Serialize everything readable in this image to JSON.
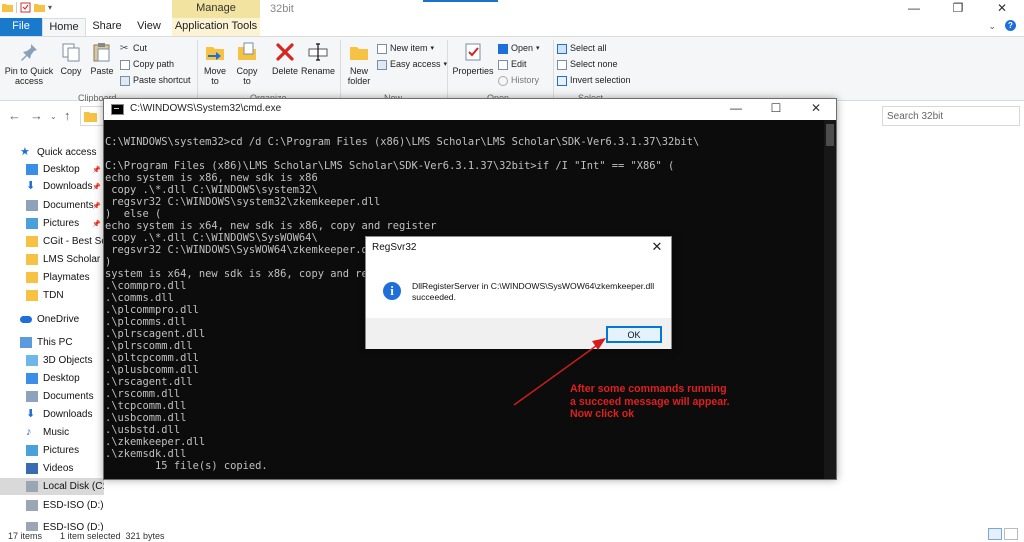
{
  "explorer": {
    "title": "32bit",
    "context_tab_header": "Manage",
    "window_controls": {
      "minimize": "—",
      "maximize": "❐",
      "close": "✕"
    },
    "ribbon_tabs": [
      "File",
      "Home",
      "Share",
      "View",
      "Application Tools"
    ],
    "ribbon": {
      "pin_to_quick_access": "Pin to Quick access",
      "copy": "Copy",
      "paste": "Paste",
      "cut": "Cut",
      "copy_path": "Copy path",
      "paste_shortcut": "Paste shortcut",
      "clipboard_group": "Clipboard",
      "move_to": "Move to",
      "copy_to": "Copy to",
      "delete": "Delete",
      "rename": "Rename",
      "organize_group": "Organize",
      "new_folder": "New folder",
      "new_item": "New item",
      "easy_access": "Easy access",
      "new_group": "New",
      "properties": "Properties",
      "open": "Open",
      "edit": "Edit",
      "history": "History",
      "open_group": "Open",
      "select_all": "Select all",
      "select_none": "Select none",
      "invert_selection": "Invert selection",
      "select_group": "Select"
    },
    "search_placeholder": "Search 32bit",
    "nav_pane": [
      {
        "label": "Quick access",
        "icon": "star-icon",
        "pinned": false
      },
      {
        "label": "Desktop",
        "icon": "desktop-icon",
        "pinned": true
      },
      {
        "label": "Downloads",
        "icon": "download-icon",
        "pinned": true
      },
      {
        "label": "Documents",
        "icon": "documents-icon",
        "pinned": true
      },
      {
        "label": "Pictures",
        "icon": "pictures-icon",
        "pinned": true
      },
      {
        "label": "CGit - Best Softw",
        "icon": "folder-icon",
        "pinned": false
      },
      {
        "label": "LMS Scholar",
        "icon": "folder-icon",
        "pinned": false
      },
      {
        "label": "Playmates",
        "icon": "folder-icon",
        "pinned": false
      },
      {
        "label": "TDN",
        "icon": "folder-icon",
        "pinned": false
      },
      {
        "label": "OneDrive",
        "icon": "cloud-icon",
        "pinned": false
      },
      {
        "label": "This PC",
        "icon": "computer-icon",
        "pinned": false
      },
      {
        "label": "3D Objects",
        "icon": "cube-icon",
        "pinned": false
      },
      {
        "label": "Desktop",
        "icon": "desktop-icon",
        "pinned": false
      },
      {
        "label": "Documents",
        "icon": "documents-icon",
        "pinned": false
      },
      {
        "label": "Downloads",
        "icon": "download-icon",
        "pinned": false
      },
      {
        "label": "Music",
        "icon": "music-icon",
        "pinned": false
      },
      {
        "label": "Pictures",
        "icon": "pictures-icon",
        "pinned": false
      },
      {
        "label": "Videos",
        "icon": "video-icon",
        "pinned": false
      },
      {
        "label": "Local Disk (C:)",
        "icon": "drive-icon",
        "pinned": false,
        "selected": true
      },
      {
        "label": "ESD-ISO (D:)",
        "icon": "drive-icon",
        "pinned": false
      },
      {
        "label": "ESD-ISO (D:)",
        "icon": "drive-icon",
        "pinned": false
      }
    ],
    "status": {
      "items": "17 items",
      "selected": "1 item selected  321 bytes"
    },
    "colors": {
      "accent": "#1979ca",
      "context_tab": "#f3e3a0"
    }
  },
  "cmd": {
    "title": "C:\\WINDOWS\\System32\\cmd.exe",
    "lines": [
      "",
      "C:\\WINDOWS\\system32>cd /d C:\\Program Files (x86)\\LMS Scholar\\LMS Scholar\\SDK-Ver6.3.1.37\\32bit\\",
      "",
      "C:\\Program Files (x86)\\LMS Scholar\\LMS Scholar\\SDK-Ver6.3.1.37\\32bit>if /I \"Int\" == \"X86\" (",
      "echo system is x86, new sdk is x86",
      " copy .\\*.dll C:\\WINDOWS\\system32\\",
      " regsvr32 C:\\WINDOWS\\system32\\zkemkeeper.dll",
      ")  else (",
      "echo system is x64, new sdk is x86, copy and register",
      " copy .\\*.dll C:\\WINDOWS\\SysWOW64\\",
      " regsvr32 C:\\WINDOWS\\SysWOW64\\zkemkeeper.dl",
      ")",
      "system is x64, new sdk is x86, copy and regi",
      ".\\commpro.dll",
      ".\\comms.dll",
      ".\\plcommpro.dll",
      ".\\plcomms.dll",
      ".\\plrscagent.dll",
      ".\\plrscomm.dll",
      ".\\pltcpcomm.dll",
      ".\\plusbcomm.dll",
      ".\\rscagent.dll",
      ".\\rscomm.dll",
      ".\\tcpcomm.dll",
      ".\\usbcomm.dll",
      ".\\usbstd.dll",
      ".\\zkemkeeper.dll",
      ".\\zkemsdk.dll",
      "        15 file(s) copied."
    ],
    "text_color": "#c0c0c0",
    "background": "#0c0c0c"
  },
  "dialog": {
    "title": "RegSvr32",
    "close": "✕",
    "message": "DllRegisterServer in C:\\WINDOWS\\SysWOW64\\zkemkeeper.dll succeeded.",
    "ok_label": "OK",
    "icon": "info-icon"
  },
  "annotation": {
    "lines": [
      "After some commands running",
      "a succeed message will appear.",
      "Now click ok"
    ],
    "color": "#e01f1f"
  }
}
